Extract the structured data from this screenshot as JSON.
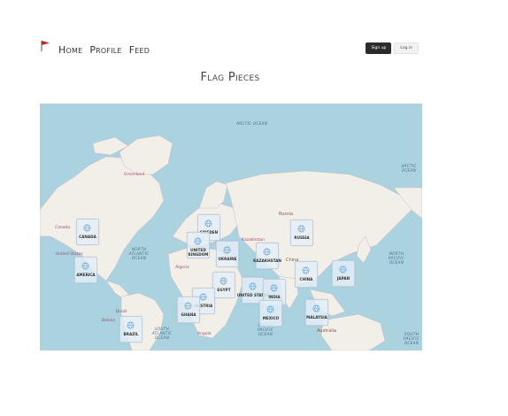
{
  "nav": {
    "links": [
      "Home",
      "Profile",
      "Feed"
    ]
  },
  "auth": {
    "signup": "Sign up",
    "login": "Log in"
  },
  "page": {
    "title": "Flag Pieces"
  },
  "map": {
    "oceans": [
      "ARCTIC OCEAN",
      "ARCTIC OCEAN",
      "NORTH ATLANTIC OCEAN",
      "NORTH PACIFIC OCEAN",
      "SOUTH ATLANTIC OCEAN",
      "NORTH PACIFIC OCEAN",
      "SOUTH PACIFIC OCEAN"
    ],
    "places": [
      "Greenland",
      "Canada",
      "United States",
      "Russia",
      "China",
      "Kazakhstan",
      "Brazil",
      "Bolivia",
      "Australia",
      "Algeria",
      "Angola"
    ],
    "markers": [
      "CANADA",
      "AMERICA",
      "SWEDEN",
      "UNITED KINGDOM",
      "UKRAINE",
      "RUSSIA",
      "KAZAKHSTAN",
      "CHINA",
      "JAPAN",
      "EGYPT",
      "UNITED STATES",
      "INDIA",
      "AUSTRIA",
      "GHANA",
      "MEXICO",
      "MALAYSIA",
      "BRAZIL"
    ]
  },
  "colors": {
    "ocean": "#aad3df",
    "land": "#f2efe9",
    "brand": "#cc2222"
  }
}
